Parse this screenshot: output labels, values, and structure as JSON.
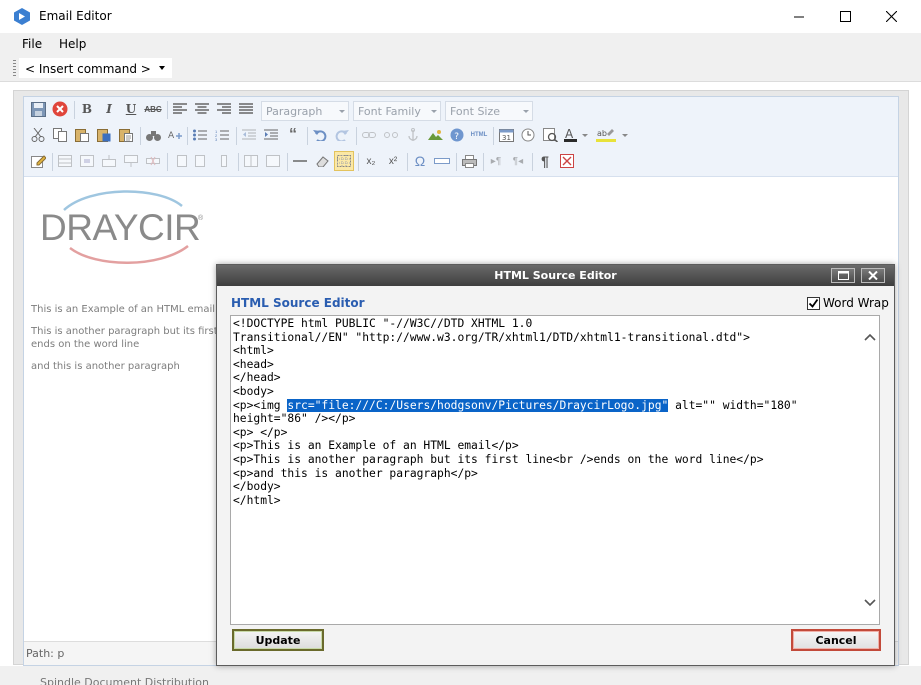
{
  "window": {
    "title": "Email Editor"
  },
  "menu": {
    "file": "File",
    "help": "Help"
  },
  "command_bar": {
    "insert_command": "< Insert command >"
  },
  "toolbar": {
    "paragraph": "Paragraph",
    "font_family": "Font Family",
    "font_size": "Font Size",
    "bold": "B",
    "italic": "I",
    "underline": "U",
    "strike": "ABC",
    "html_mode": "HTML",
    "omega": "Ω",
    "subscript": "x₂",
    "superscript": "x²",
    "pilcrow": "¶"
  },
  "content": {
    "logo_text": "DRAYCIR",
    "p1": "This is an Example of an HTML email",
    "p2_line1": "This is another paragraph but its first",
    "p2_line2": "ends on the word line",
    "p3": "and this is another paragraph"
  },
  "path": {
    "label": "Path: p"
  },
  "background": {
    "text": "Spindle Document Distribution"
  },
  "dialog": {
    "title": "HTML Source Editor",
    "heading": "HTML Source Editor",
    "word_wrap": "Word Wrap",
    "word_wrap_checked": true,
    "source_before": "<!DOCTYPE html PUBLIC \"-//W3C//DTD XHTML 1.0\nTransitional//EN\" \"http://www.w3.org/TR/xhtml1/DTD/xhtml1-transitional.dtd\">\n<html>\n<head>\n</head>\n<body>\n<p><img ",
    "source_selected": "src=\"file:///C:/Users/hodgsonv/Pictures/DraycirLogo.jpg\"",
    "source_after": " alt=\"\" width=\"180\"\nheight=\"86\" /></p>\n<p> </p>\n<p>This is an Example of an HTML email</p>\n<p>This is another paragraph but its first line<br />ends on the word line</p>\n<p>and this is another paragraph</p>\n</body>\n</html>",
    "update": "Update",
    "cancel": "Cancel"
  },
  "colors": {
    "accent": "#2a5db0",
    "selection": "#0a64c8",
    "logo_gray": "#8a8a8a",
    "logo_red": "#e3a0a0",
    "logo_blue": "#9fc6e0"
  }
}
